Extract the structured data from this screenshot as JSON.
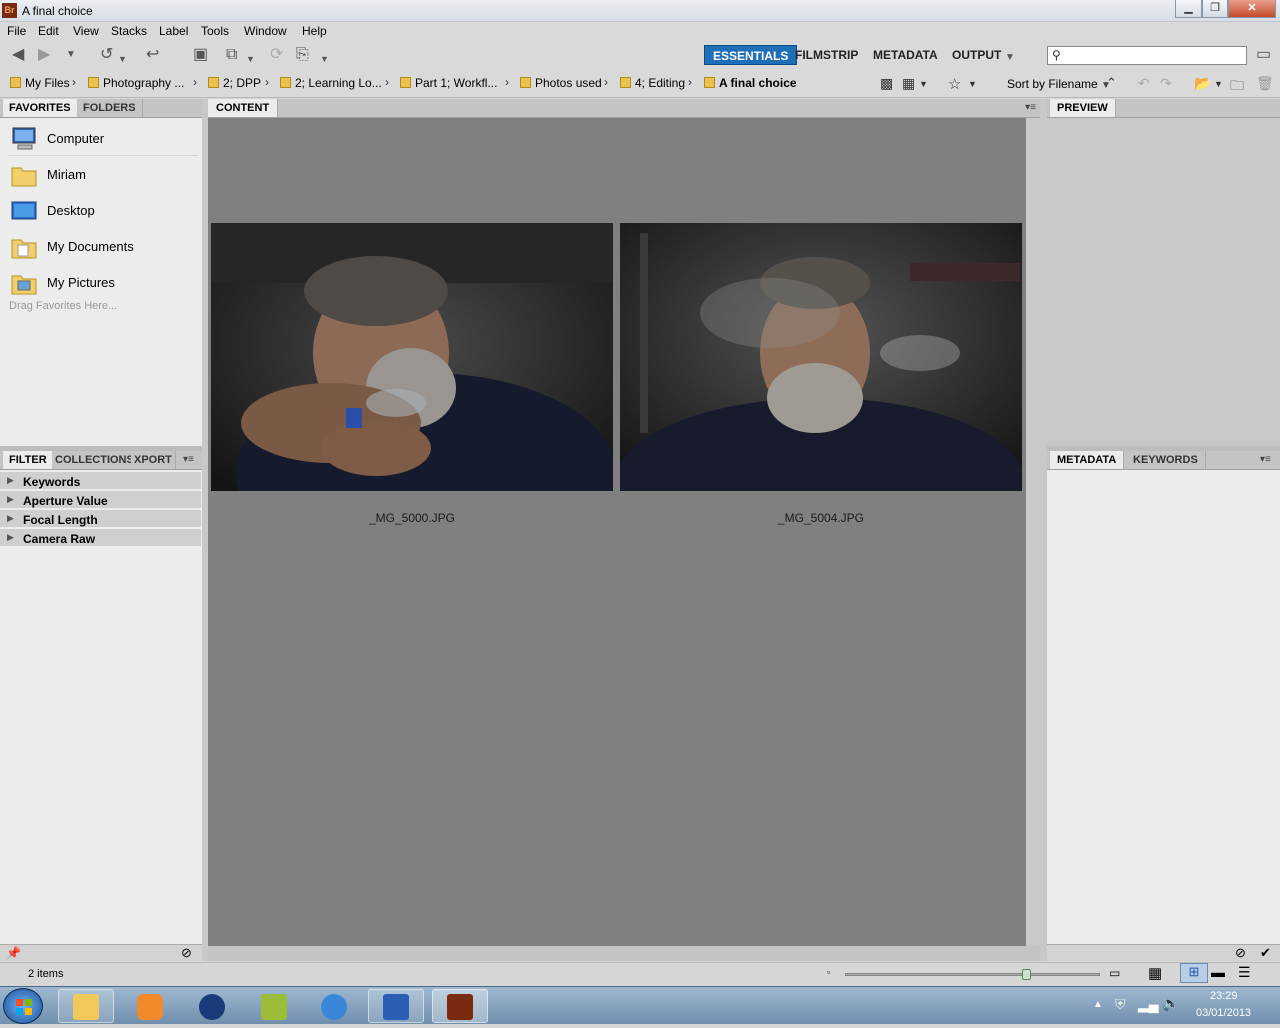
{
  "window": {
    "title": "A final choice",
    "app_icon": "Br"
  },
  "menu": [
    "File",
    "Edit",
    "View",
    "Stacks",
    "Label",
    "Tools",
    "Window",
    "Help"
  ],
  "workspaces": {
    "essentials": "ESSENTIALS",
    "filmstrip": "FILMSTRIP",
    "metadata": "METADATA",
    "output": "OUTPUT"
  },
  "search": {
    "placeholder": "",
    "icon": "search-icon"
  },
  "breadcrumb": [
    "My Files",
    "Photography ...",
    "2; DPP",
    "2; Learning Lo...",
    "Part 1; Workfl...",
    "Photos used",
    "4; Editing",
    "A final choice"
  ],
  "sort": {
    "label": "Sort by Filename"
  },
  "panels": {
    "favorites_tab": "FAVORITES",
    "folders_tab": "FOLDERS",
    "content_tab": "CONTENT",
    "preview_tab": "PREVIEW",
    "filter_tab": "FILTER",
    "collections_tab": "COLLECTIONS",
    "export_tab": "XPORT",
    "metadata_tab": "METADATA",
    "keywords_tab": "KEYWORDS"
  },
  "favorites": [
    {
      "label": "Computer",
      "icon": "computer-icon"
    },
    {
      "label": "Miriam",
      "icon": "folder-icon"
    },
    {
      "label": "Desktop",
      "icon": "desktop-icon"
    },
    {
      "label": "My Documents",
      "icon": "folder-icon"
    },
    {
      "label": "My Pictures",
      "icon": "folder-icon"
    }
  ],
  "favorites_hint": "Drag Favorites Here...",
  "filters": [
    "Keywords",
    "Aperture Value",
    "Focal Length",
    "Camera Raw"
  ],
  "thumbnails": [
    {
      "filename": "_MG_5000.JPG"
    },
    {
      "filename": "_MG_5004.JPG"
    }
  ],
  "status": {
    "count": "2 items"
  },
  "thumbnail_zoom": 0.72,
  "clock": {
    "time": "23:29",
    "date": "03/01/2013"
  },
  "colors": {
    "accent": "#1f6fb8",
    "content_bg": "#808080",
    "panel_bg": "#ececec"
  }
}
